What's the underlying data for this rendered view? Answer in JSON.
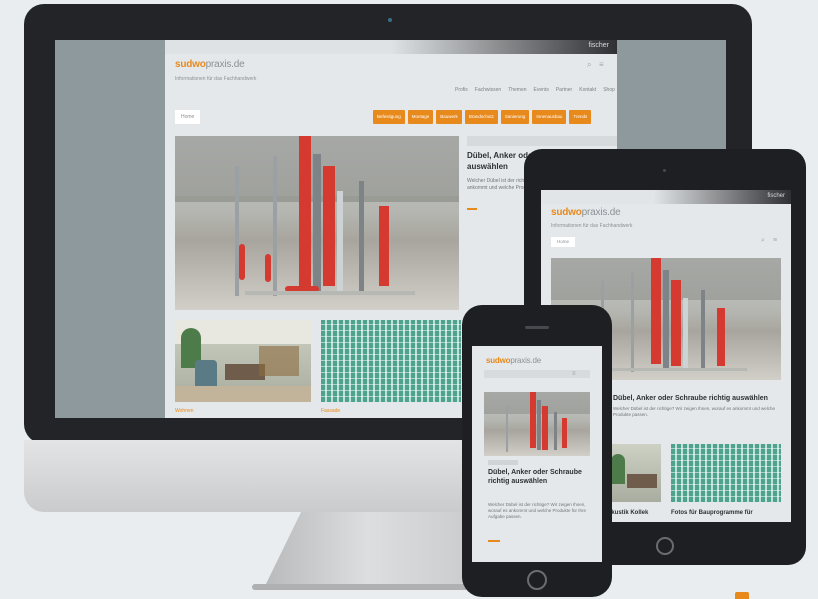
{
  "site": {
    "logo_bold": "sudwo",
    "logo_rest": "praxis.de",
    "tagline": "Informationen für das Fachhandwerk",
    "header_strip": "fischer",
    "nav": [
      "Profis",
      "Fachwissen",
      "Themen",
      "Events",
      "Partner",
      "Kontakt",
      "Shop"
    ],
    "home_label": "Home",
    "categories": [
      "Befestigung",
      "Montage",
      "Bauwerk",
      "Brandschutz",
      "Sanierung",
      "Innenausbau",
      "Trends"
    ]
  },
  "imac": {
    "feature": {
      "kicker": "Dübel",
      "title": "Dübel, Anker oder Schraube richtig auswählen",
      "excerpt": "Welcher Dübel ist der richtige? Wir zeigen Ihnen, worauf es ankommt und welche Produkte für Ihre Aufgabe passen."
    },
    "thumbs": [
      "Wohnen",
      "Fassade"
    ]
  },
  "tablet": {
    "feature_title": "Dübel, Anker oder Schraube richtig auswählen",
    "feature_excerpt": "Welcher Dübel ist der richtige? Wir zeigen Ihnen, worauf es ankommt und welche Produkte passen.",
    "thumb_captions": [
      "Akustik Kollek",
      "Fotos für Bauprogramme für"
    ]
  },
  "phone": {
    "title": "Dübel, Anker oder Schraube richtig auswählen",
    "excerpt": "Welcher Dübel ist der richtige? Wir zeigen Ihnen, worauf es ankommt und welche Produkte für Ihre Aufgabe passen."
  },
  "colors": {
    "accent": "#e8891c",
    "device": "#232427",
    "page": "#e4e8ea"
  }
}
